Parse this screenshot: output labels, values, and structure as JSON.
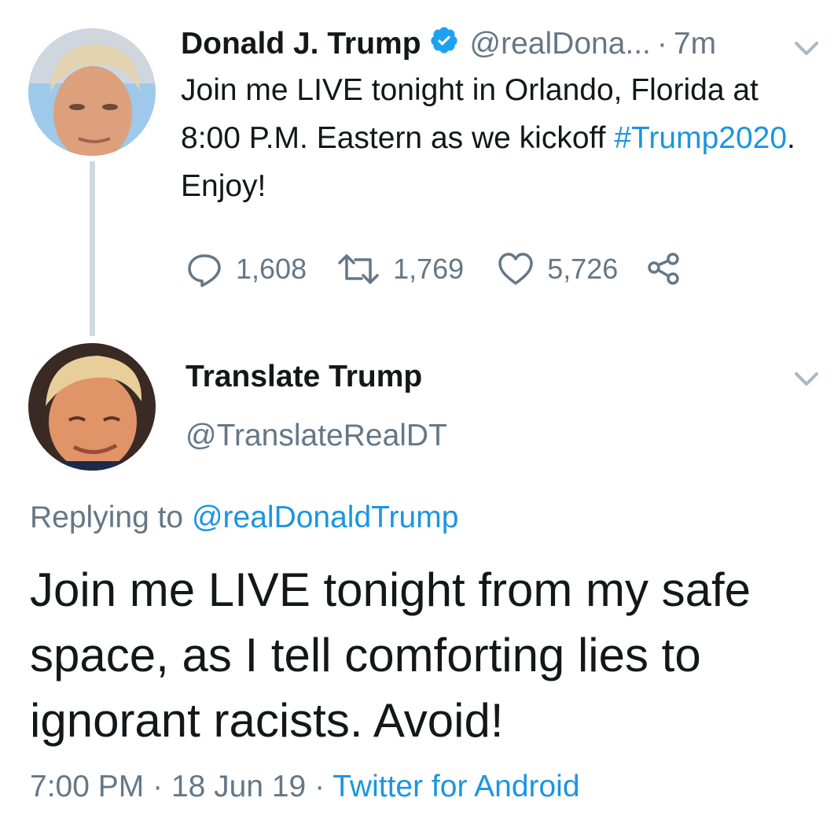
{
  "original_tweet": {
    "display_name": "Donald J. Trump",
    "handle": "@realDona...",
    "separator": "·",
    "time": "7m",
    "text_part1": "Join me LIVE tonight in Orlando, Florida at 8:00 P.M. Eastern as we kickoff ",
    "hashtag": "#Trump2020",
    "text_part2": ". Enjoy!",
    "replies": "1,608",
    "retweets": "1,769",
    "likes": "5,726"
  },
  "reply_tweet": {
    "display_name": "Translate Trump",
    "handle": "@TranslateRealDT",
    "replying_prefix": "Replying to ",
    "replying_to": "@realDonaldTrump",
    "text": "Join me LIVE tonight from my safe space, as I tell comforting lies to ignorant racists. Avoid!",
    "time": "7:00 PM",
    "sep1": "·",
    "date": "18 Jun 19",
    "sep2": "·",
    "source": "Twitter for Android"
  },
  "colors": {
    "link": "#1b95e0",
    "verified": "#1da1f2",
    "secondary_text": "#657786",
    "thread_line": "#cfd9de"
  },
  "icons": [
    "verified-badge-icon",
    "chevron-down-icon",
    "reply-icon",
    "retweet-icon",
    "like-icon",
    "share-icon"
  ]
}
